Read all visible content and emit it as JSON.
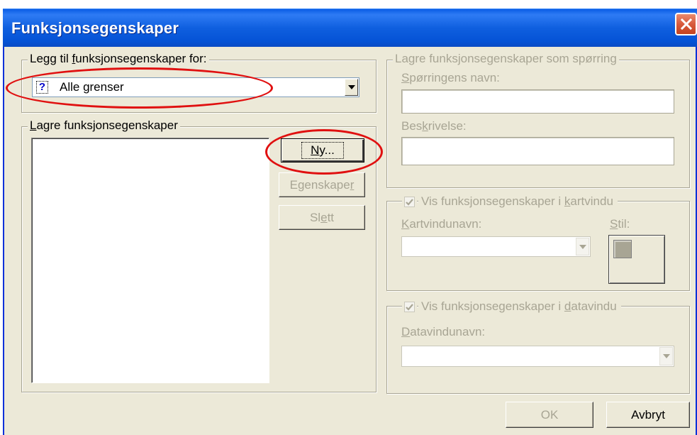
{
  "window": {
    "title": "Funksjonsegenskaper"
  },
  "left": {
    "add_group": {
      "legend_pre": "Legg til ",
      "legend_accel": "f",
      "legend_post": "unksjonsegenskaper for:",
      "selected_icon": "question-mark-icon",
      "selected_value": "Alle grenser"
    },
    "store_group": {
      "legend_accel": "L",
      "legend_post": "agre funksjonsegenskaper",
      "new_button": {
        "accel": "N",
        "rest": "y..."
      },
      "properties_button": {
        "pre": "Egenskape",
        "accel": "r"
      },
      "delete_button": {
        "pre": "Sl",
        "accel": "e",
        "post": "tt"
      }
    }
  },
  "right": {
    "query_group": {
      "legend": "Lagre funksjonsegenskaper som spørring",
      "name_label": {
        "accel": "S",
        "rest": "pørringens navn:"
      },
      "name_value": "",
      "desc_label": {
        "pre": "Bes",
        "accel": "k",
        "post": "rivelse:"
      },
      "desc_value": ""
    },
    "map_group": {
      "checkbox_label": {
        "pre": "Vis funksjonsegenskaper i ",
        "accel": "k",
        "post": "artvindu"
      },
      "checked": true,
      "window_label": {
        "accel": "K",
        "rest": "artvindunavn:"
      },
      "window_value": "",
      "style_label": {
        "accel": "S",
        "rest": "til:"
      }
    },
    "data_group": {
      "checkbox_label": {
        "pre": "Vis funksjonsegenskaper i ",
        "accel": "d",
        "post": "atavindu"
      },
      "checked": true,
      "window_label": {
        "accel": "D",
        "rest": "atavindunavn:"
      },
      "window_value": ""
    }
  },
  "footer": {
    "ok_label": "OK",
    "cancel_label": "Avbryt"
  },
  "colors": {
    "titlebar": "#0553d6",
    "dialog_bg": "#ece9d8",
    "disabled_text": "#a8a594",
    "highlight_ellipse": "#e01010"
  }
}
